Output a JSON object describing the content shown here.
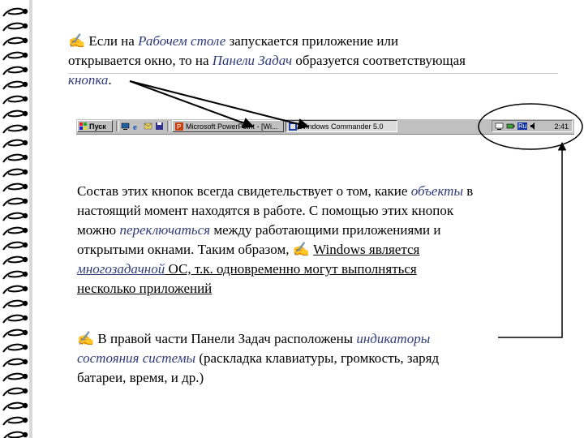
{
  "paragraph1": {
    "icon": "writing-hand-icon",
    "t1": "✍ Если на ",
    "desktop": "Рабочем столе",
    "t2": " запускается приложение или",
    "t3": "открывается окно, то на ",
    "taskbar_term": "Панели Задач",
    "t4": " образуется соответствующая",
    "button_term": "кнопка",
    "t5": "."
  },
  "taskbar": {
    "start_label": "Пуск",
    "buttons": [
      {
        "label": "Microsoft PowerPoint - [Wi...",
        "active": false
      },
      {
        "label": "Windows Commander 5.0",
        "active": true
      }
    ],
    "tray": {
      "lang": "Ru",
      "time": "2:41"
    }
  },
  "paragraph2": {
    "t1": "Состав этих кнопок всегда свидетельствует о том, какие ",
    "objects": "объекты",
    "t2": " в",
    "t3": "настоящий момент находятся в работе. С помощью этих кнопок",
    "t4": "можно ",
    "switch": "переключаться",
    "t5": " между работающими приложениями и",
    "t6": "открытыми окнами. Таким образом, ✍  ",
    "t7": "Windows является",
    "multitask": "многозадачной",
    "t8": " ОС, т.к. одновременно могут выполняться",
    "t9": "несколько приложений"
  },
  "paragraph3": {
    "t1": "✍ В правой части Панели Задач расположены ",
    "indicators": "индикаторы",
    "status": "состояния системы",
    "t2": " (раскладка клавиатуры, громкость, заряд",
    "t3": "батареи, время, и др.)"
  },
  "colors": {
    "accent": "#2f3b7a",
    "taskbar": "#c0c0c0"
  }
}
